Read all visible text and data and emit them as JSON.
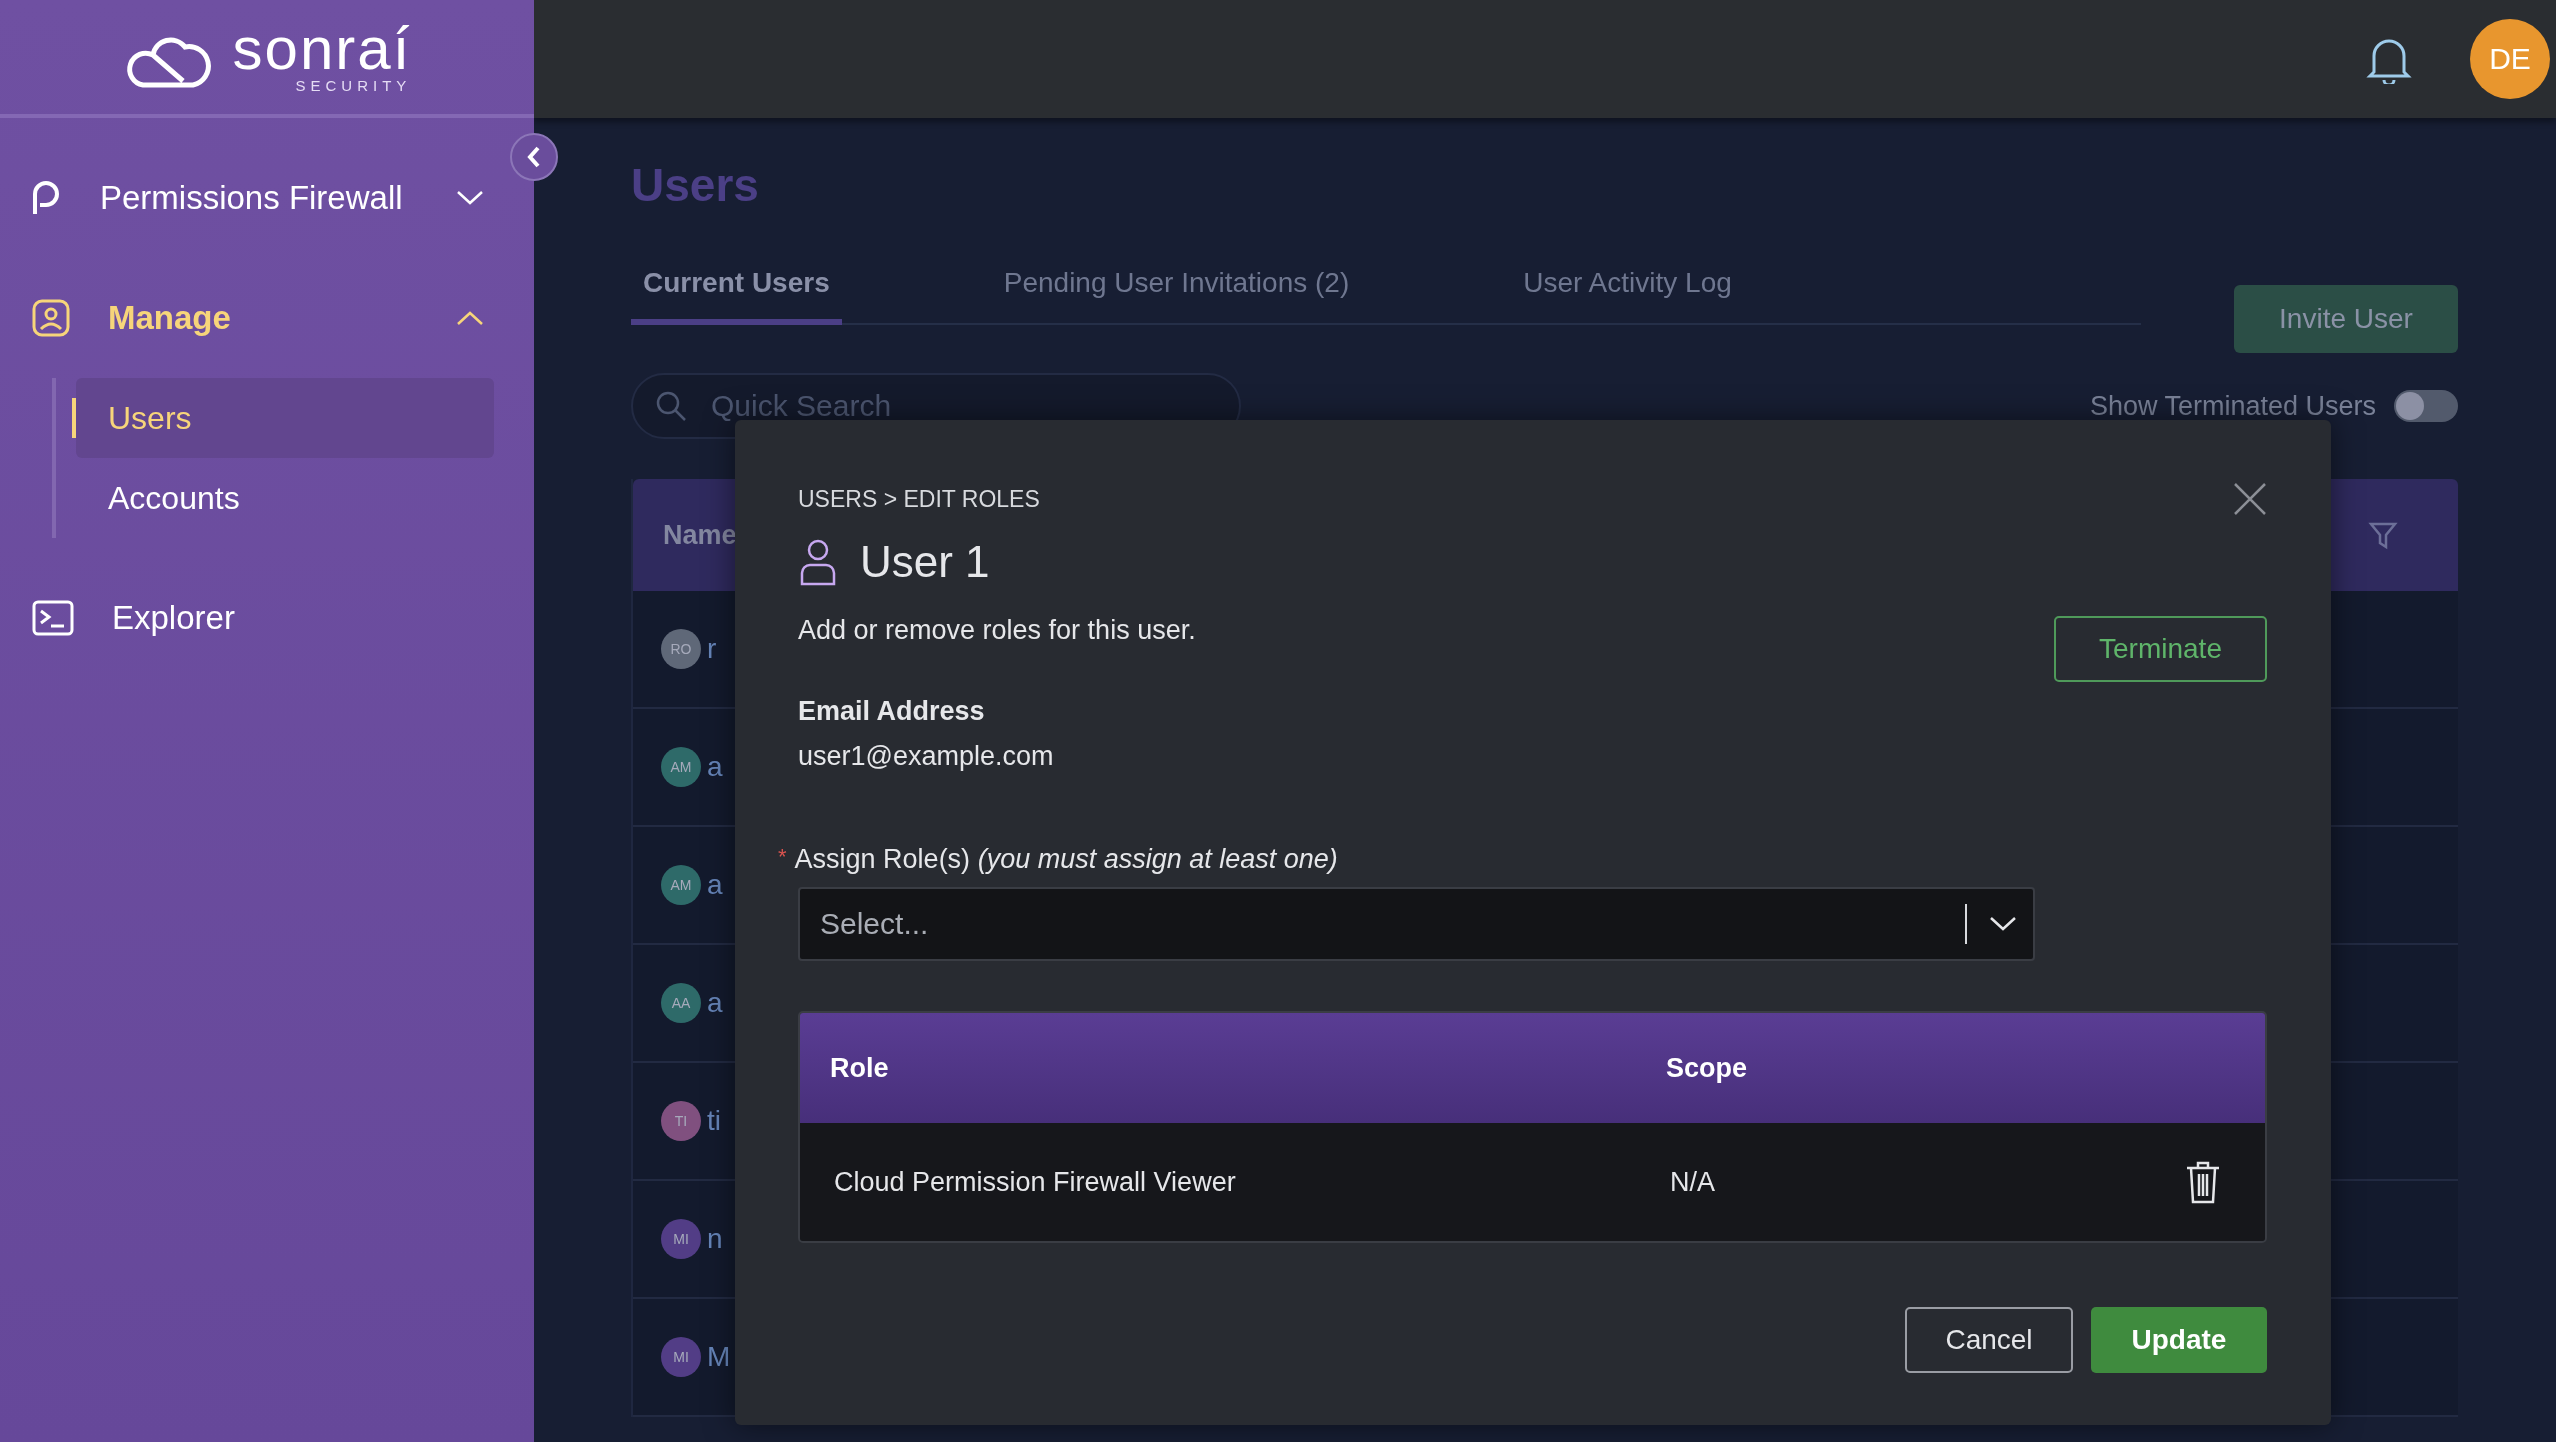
{
  "sidebar": {
    "logo": {
      "name": "sonraí",
      "tagline": "SECURITY"
    },
    "items": [
      {
        "label": "Permissions Firewall",
        "expanded": false,
        "selected": false
      },
      {
        "label": "Manage",
        "expanded": true,
        "selected": true,
        "children": [
          {
            "label": "Users",
            "selected": true
          },
          {
            "label": "Accounts",
            "selected": false
          }
        ]
      },
      {
        "label": "Explorer",
        "selected": false
      }
    ]
  },
  "header": {
    "avatar": "DE"
  },
  "page": {
    "title": "Users",
    "tabs": [
      {
        "label": "Current Users",
        "selected": true
      },
      {
        "label": "Pending User Invitations (2)",
        "selected": false
      },
      {
        "label": "User Activity Log",
        "selected": false
      }
    ],
    "invite_button": "Invite User",
    "toggle": {
      "label": "Show Terminated Users",
      "on": false
    },
    "search": {
      "placeholder": "Quick Search"
    },
    "table": {
      "columns": [
        "Name"
      ],
      "rows": [
        {
          "initials": "RO",
          "color": "#5f6878",
          "name": "r"
        },
        {
          "initials": "AM",
          "color": "#2e6a69",
          "name": "a"
        },
        {
          "initials": "AM",
          "color": "#2e6a69",
          "name": "a"
        },
        {
          "initials": "AA",
          "color": "#2e6a69",
          "name": "a"
        },
        {
          "initials": "TI",
          "color": "#80507f",
          "name": "ti"
        },
        {
          "initials": "MI",
          "color": "#523d86",
          "name": "n"
        },
        {
          "initials": "MI",
          "color": "#523d86",
          "name": "M"
        }
      ]
    }
  },
  "modal": {
    "breadcrumb": "USERS > EDIT ROLES",
    "title": "User 1",
    "description": "Add or remove roles for this user.",
    "terminate_button": "Terminate",
    "email": {
      "label": "Email Address",
      "value": "user1@example.com"
    },
    "assign": {
      "label": "Assign Role(s)",
      "hint": "(you must assign at least one)",
      "required_mark": "*",
      "placeholder": "Select..."
    },
    "roles_table": {
      "columns": [
        "Role",
        "Scope"
      ],
      "rows": [
        {
          "role": "Cloud Permission Firewall Viewer",
          "scope": "N/A"
        }
      ]
    },
    "buttons": {
      "cancel": "Cancel",
      "update": "Update"
    }
  }
}
